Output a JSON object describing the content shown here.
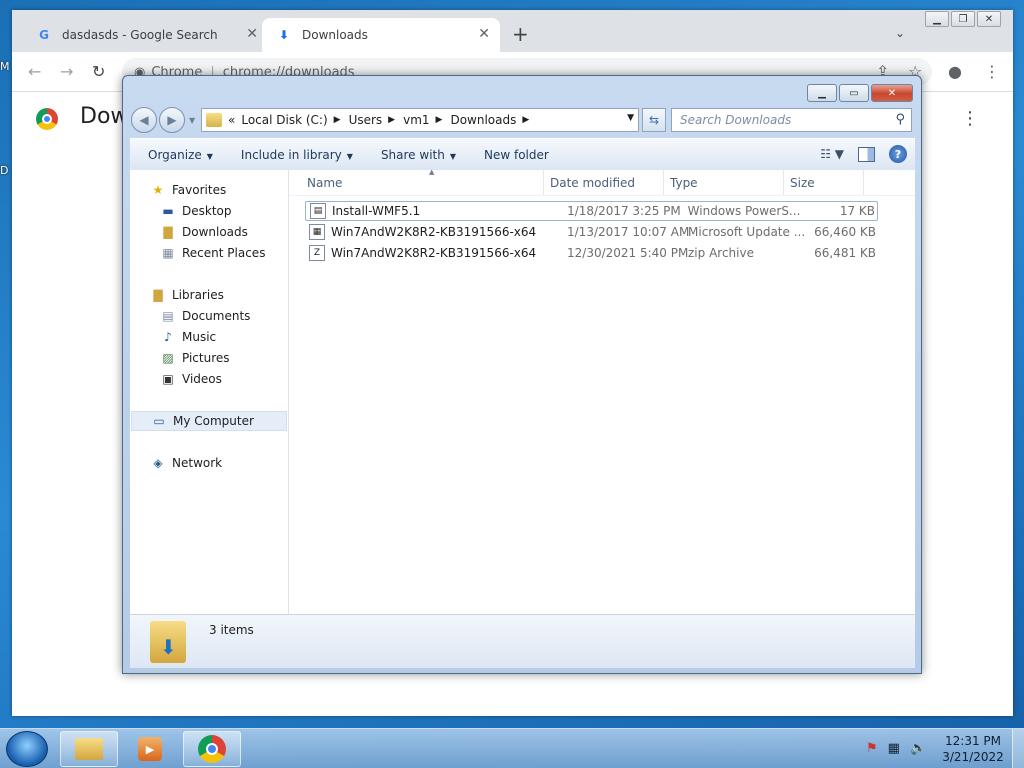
{
  "desktop": {
    "label_m": "M",
    "label_d": "D"
  },
  "chrome": {
    "tabs": [
      {
        "title": "dasdasds - Google Search",
        "icon": "google-g-icon"
      },
      {
        "title": "Downloads",
        "icon": "download-arrow-icon"
      }
    ],
    "new_tab": "+",
    "address": {
      "site_label": "Chrome",
      "url": "chrome://downloads"
    },
    "page_title": "Downloads"
  },
  "explorer": {
    "breadcrumb": [
      "Local Disk (C:)",
      "Users",
      "vm1",
      "Downloads"
    ],
    "breadcrumb_overflow": "«",
    "search_placeholder": "Search Downloads",
    "commands": [
      "Organize",
      "Include in library",
      "Share with",
      "New folder"
    ],
    "nav": {
      "favorites": {
        "label": "Favorites",
        "items": [
          "Desktop",
          "Downloads",
          "Recent Places"
        ]
      },
      "libraries": {
        "label": "Libraries",
        "items": [
          "Documents",
          "Music",
          "Pictures",
          "Videos"
        ]
      },
      "computer": "My Computer",
      "network": "Network"
    },
    "columns": [
      "Name",
      "Date modified",
      "Type",
      "Size"
    ],
    "files": [
      {
        "name": "Install-WMF5.1",
        "date": "1/18/2017 3:25 PM",
        "type": "Windows PowerS...",
        "size": "17 KB",
        "icon": "powershell-script-icon"
      },
      {
        "name": "Win7AndW2K8R2-KB3191566-x64",
        "date": "1/13/2017 10:07 AM",
        "type": "Microsoft Update ...",
        "size": "66,460 KB",
        "icon": "update-package-icon"
      },
      {
        "name": "Win7AndW2K8R2-KB3191566-x64",
        "date": "12/30/2021 5:40 PM",
        "type": "zip Archive",
        "size": "66,481 KB",
        "icon": "zip-archive-icon"
      }
    ],
    "status": "3 items"
  },
  "taskbar": {
    "time": "12:31 PM",
    "date": "3/21/2022"
  }
}
